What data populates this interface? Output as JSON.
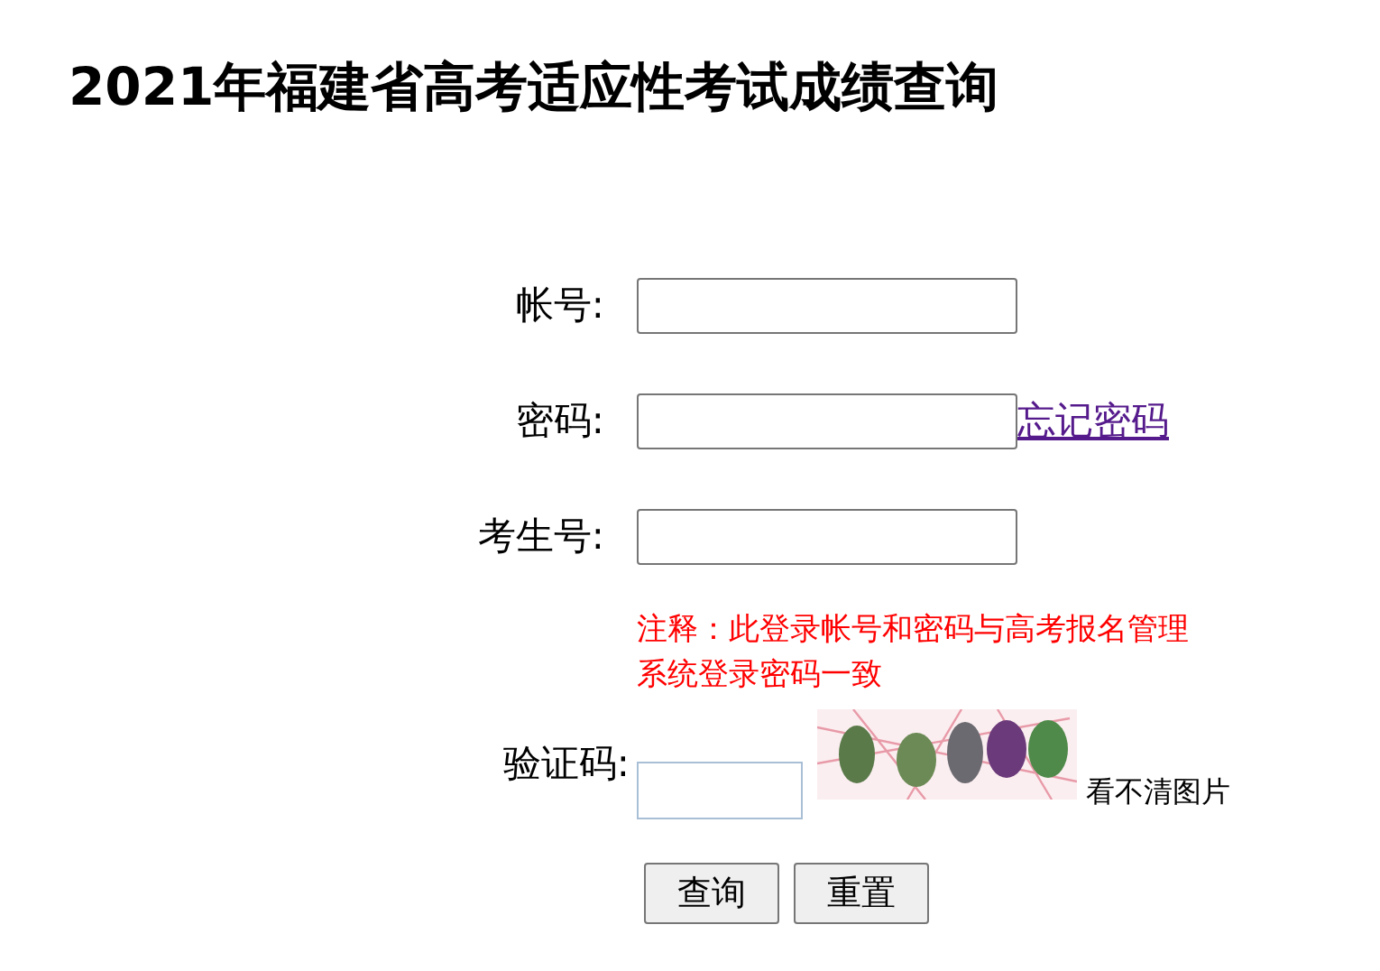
{
  "title": "2021年福建省高考适应性考试成绩查询",
  "fields": [
    {
      "label": "帐号:"
    },
    {
      "label": "密码:",
      "link": "忘记密码"
    },
    {
      "label": "考生号:"
    }
  ],
  "note": "注释：此登录帐号和密码与高考报名管理系统登录密码一致",
  "captcha": {
    "label": "验证码:",
    "refresh_link": "看不清图片"
  },
  "buttons": [
    "查询",
    "重置"
  ]
}
